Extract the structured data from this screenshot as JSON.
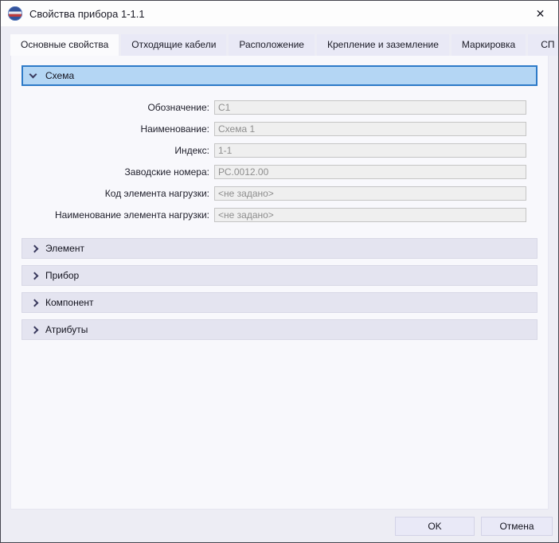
{
  "window": {
    "title": "Свойства прибора 1-1.1"
  },
  "icons": {
    "close_glyph": "✕"
  },
  "tabs": [
    {
      "label": "Основные свойства",
      "active": true
    },
    {
      "label": "Отходящие кабели",
      "active": false
    },
    {
      "label": "Расположение",
      "active": false
    },
    {
      "label": "Крепление и заземление",
      "active": false
    },
    {
      "label": "Маркировка",
      "active": false
    },
    {
      "label": "СП",
      "active": false
    }
  ],
  "schema_section": {
    "title": "Схема",
    "expanded": true,
    "fields": [
      {
        "label": "Обозначение:",
        "value": "С1"
      },
      {
        "label": "Наименование:",
        "value": "Схема 1"
      },
      {
        "label": "Индекс:",
        "value": "1-1"
      },
      {
        "label": "Заводские номера:",
        "value": "РС.0012.00"
      },
      {
        "label": "Код элемента нагрузки:",
        "value": "<не задано>"
      },
      {
        "label": "Наименование элемента нагрузки:",
        "value": "<не задано>"
      }
    ]
  },
  "collapsed_sections": [
    {
      "title": "Элемент"
    },
    {
      "title": "Прибор"
    },
    {
      "title": "Компонент"
    },
    {
      "title": "Атрибуты"
    }
  ],
  "footer": {
    "ok_label": "OK",
    "cancel_label": "Отмена"
  },
  "colors": {
    "accent_header_bg": "#b4d6f4",
    "accent_header_border": "#2d7ac8",
    "collapsed_header_bg": "#e4e4f0",
    "dialog_bg": "#ededf5",
    "panel_bg": "#f8f8fc",
    "disabled_input_bg": "#efefef",
    "disabled_input_text": "#8e8e8e"
  }
}
